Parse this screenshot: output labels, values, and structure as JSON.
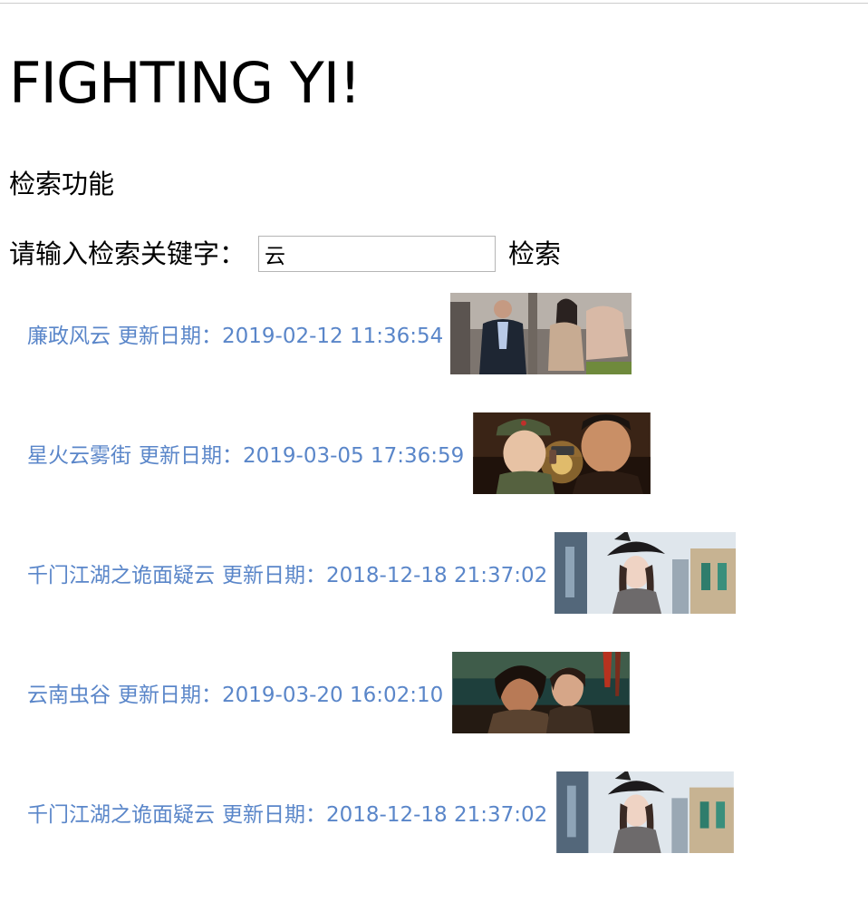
{
  "header": {
    "title": "FIGHTING YI!"
  },
  "search": {
    "section_title": "检索功能",
    "label": "请输入检索关键字：",
    "value": "云",
    "button_label": "检索"
  },
  "results": [
    {
      "title": "廉政风云",
      "date_text": "更新日期：2019-02-12 11:36:54",
      "thumb": "poster-two-people-street"
    },
    {
      "title": "星火云雾街",
      "date_text": "更新日期：2019-03-05 17:36:59",
      "thumb": "poster-soldier-pistol"
    },
    {
      "title": "千门江湖之诡面疑云",
      "date_text": "更新日期：2018-12-18 21:37:02",
      "thumb": "poster-woman-black-hat"
    },
    {
      "title": "云南虫谷",
      "date_text": "更新日期：2019-03-20 16:02:10",
      "thumb": "poster-two-adventurers"
    },
    {
      "title": "千门江湖之诡面疑云",
      "date_text": "更新日期：2018-12-18 21:37:02",
      "thumb": "poster-woman-black-hat"
    }
  ]
}
